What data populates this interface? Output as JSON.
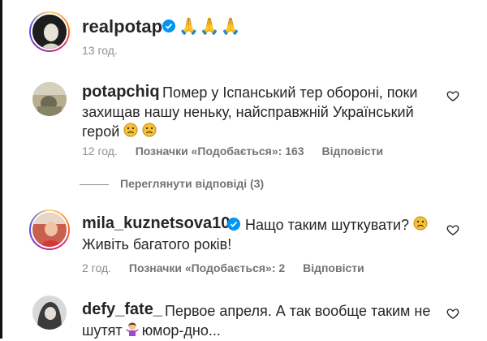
{
  "post": {
    "username": "realpotap",
    "time": "13 год."
  },
  "comments": [
    {
      "username": "potapchiq",
      "text_line1": "Помер у Іспанський тер обороні, поки",
      "text_line2": "захищав нашу неньку, найсправжній Український",
      "text_line3": "герой",
      "time": "12 год.",
      "likes_label": "Позначки «Подобається»: 163",
      "reply_label": "Відповісти",
      "verified": false
    },
    {
      "username": "mila_kuznetsova10",
      "text_line1": "Нащо таким шуткувати?",
      "text_line2": "Живіть багатого років!",
      "time": "2 год.",
      "likes_label": "Позначки «Подобається»: 2",
      "reply_label": "Відповісти",
      "verified": true
    },
    {
      "username": "defy_fate_",
      "text_line1": "Первое апреля. А так вообще таким не",
      "text_line2_a": "шутят",
      "text_line2_b": "юмор-дно...",
      "verified": false
    }
  ],
  "view_replies": "Переглянути відповіді (3)",
  "colors": {
    "verified": "#0095f6",
    "muted": "#8e8e8e",
    "text": "#262626"
  }
}
